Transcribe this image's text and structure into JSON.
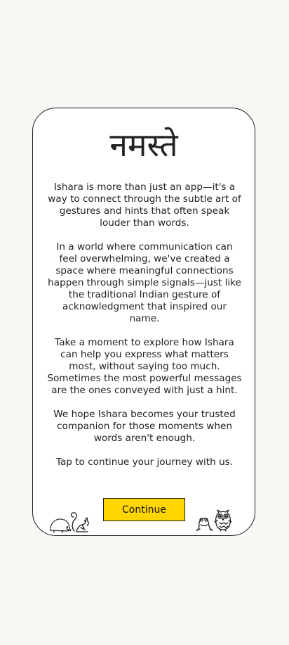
{
  "card": {
    "title": "नमस्ते",
    "paragraphs": [
      "Ishara is more than just an app—it's a way to connect through the subtle art of gestures and hints that often speak louder than words.",
      "In a world where communication can feel overwhelming, we've created a space where meaningful connections happen through simple signals—just like the traditional Indian gesture of acknowledgment that inspired our name.",
      "Take a moment to explore how Ishara can help you express what matters most, without saying too much. Sometimes the most powerful messages are the ones conveyed with just a hint.",
      "We hope Ishara becomes your trusted companion for those moments when words aren't enough.",
      "Tap to continue your journey with us."
    ],
    "continue_label": "Continue"
  },
  "colors": {
    "background": "#f8f7f3",
    "card": "#ffffff",
    "accent": "#ffd500",
    "ink": "#1a1a1a"
  },
  "icons": {
    "left": [
      "hedgehog-icon",
      "squirrel-icon"
    ],
    "right": [
      "frog-icon",
      "owl-icon"
    ]
  }
}
